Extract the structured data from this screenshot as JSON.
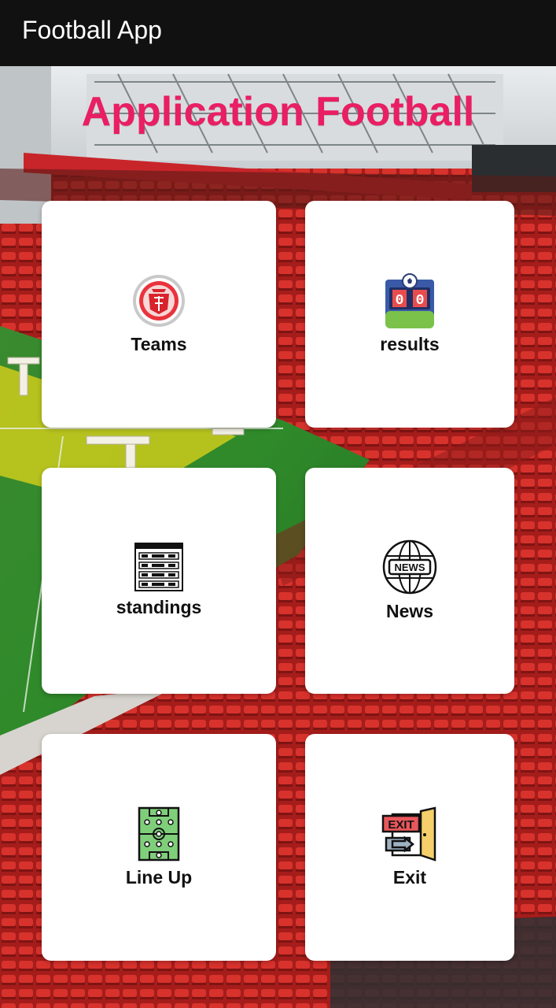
{
  "appbar": {
    "title": "Football App"
  },
  "headline": {
    "text": "Application Football",
    "color": "#e91e63"
  },
  "cards": [
    {
      "label": "Teams",
      "icon": "club-crest-icon"
    },
    {
      "label": "results",
      "icon": "scoreboard-icon"
    },
    {
      "label": "standings",
      "icon": "standings-table-icon"
    },
    {
      "label": "News",
      "icon": "news-globe-icon"
    },
    {
      "label": "Line Up",
      "icon": "pitch-lineup-icon"
    },
    {
      "label": "Exit",
      "icon": "exit-door-icon"
    }
  ],
  "scoreboard": {
    "home": "0",
    "away": "0"
  },
  "icon_texts": {
    "news": "NEWS",
    "exit": "EXIT"
  }
}
